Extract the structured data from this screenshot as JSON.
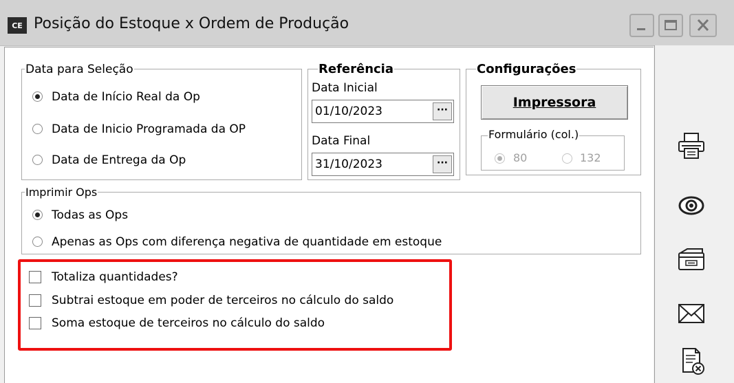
{
  "window": {
    "app_icon_text": "CE",
    "title": "Posição do Estoque x Ordem de Produção",
    "buttons": [
      "minimize",
      "maximize",
      "close"
    ]
  },
  "data_selecao": {
    "title": "Data para Seleção",
    "options": [
      {
        "label": "Data de Início Real da Op",
        "checked": true
      },
      {
        "label": "Data de Inicio Programada da OP",
        "checked": false
      },
      {
        "label": "Data de Entrega da Op",
        "checked": false
      }
    ]
  },
  "referencia": {
    "title": "Referência",
    "data_inicial_label": "Data Inicial",
    "data_inicial_value": "01/10/2023",
    "data_final_label": "Data Final",
    "data_final_value": "31/10/2023",
    "picker_button": "···"
  },
  "configuracoes": {
    "title": "Configurações",
    "impressora_button": "Impressora",
    "formulario_title": "Formulário (col.)",
    "formulario_options": [
      {
        "label": "80",
        "checked": true
      },
      {
        "label": "132",
        "checked": false
      }
    ]
  },
  "imprimir_ops": {
    "title": "Imprimir Ops",
    "options": [
      {
        "label": "Todas as Ops",
        "checked": true
      },
      {
        "label": "Apenas as Ops com diferença negativa de quantidade em estoque",
        "checked": false
      }
    ]
  },
  "checkboxes": [
    {
      "label": "Totaliza quantidades?",
      "checked": false
    },
    {
      "label": "Subtrai estoque em poder de terceiros no cálculo do saldo",
      "checked": false
    },
    {
      "label": "Soma estoque de terceiros no cálculo do saldo",
      "checked": false
    }
  ],
  "side_actions": [
    "printer-icon",
    "preview-eye-icon",
    "printer-setup-icon",
    "email-envelope-icon",
    "export-document-icon"
  ],
  "colors": {
    "highlight_border": "#ee1111",
    "titlebar": "#d2d2d2"
  }
}
